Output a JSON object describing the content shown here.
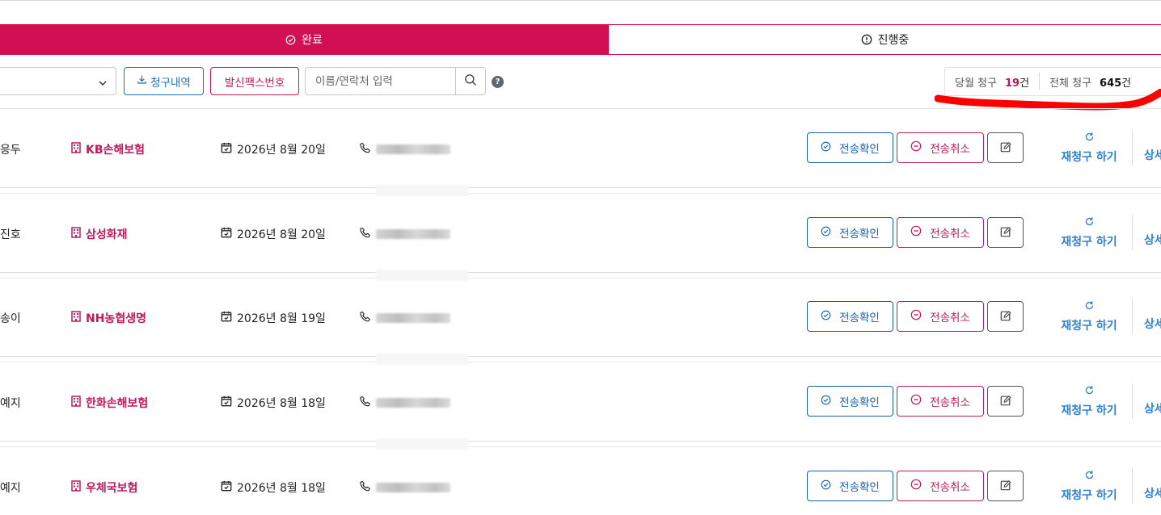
{
  "tabs": {
    "done_label": "완료",
    "progress_label": "진행중"
  },
  "toolbar": {
    "history_label": "청구내역",
    "fax_label": "발신팩스번호",
    "search_placeholder": "이름/연락처 입력",
    "help_symbol": "?"
  },
  "stats": {
    "month_label": "당월 청구",
    "month_count": "19",
    "total_label": "전체 청구",
    "total_count": "645",
    "unit": "건"
  },
  "row_actions": {
    "confirm_label": "전송확인",
    "cancel_label": "전송취소",
    "reclaim_label": "재청구 하기",
    "detail_label": "상세"
  },
  "rows": [
    {
      "name": "응두",
      "insurer": "KB손해보험",
      "date": "2026년 8월 20일"
    },
    {
      "name": "진호",
      "insurer": "삼성화재",
      "date": "2026년 8월 20일"
    },
    {
      "name": "송이",
      "insurer": "NH농협생명",
      "date": "2026년 8월 19일"
    },
    {
      "name": "예지",
      "insurer": "한화손해보험",
      "date": "2026년 8월 18일"
    },
    {
      "name": "예지",
      "insurer": "우체국보험",
      "date": "2026년 8월 18일"
    }
  ],
  "colors": {
    "accent": "#d20f52",
    "brand_pink": "#c2185b",
    "brand_blue": "#1a73b9",
    "link_blue": "#2f7fd1",
    "marker_red": "#ff0000"
  },
  "icons": {
    "done_tab": "check-circle-icon",
    "progress_tab": "exclamation-circle-icon",
    "history": "download-icon",
    "search": "magnifier-icon",
    "insurer": "building-icon",
    "date": "calendar-check-icon",
    "phone": "phone-icon",
    "confirm": "check-circle-icon",
    "cancel": "minus-circle-icon",
    "edit": "edit-icon",
    "reclaim": "refresh-icon"
  }
}
